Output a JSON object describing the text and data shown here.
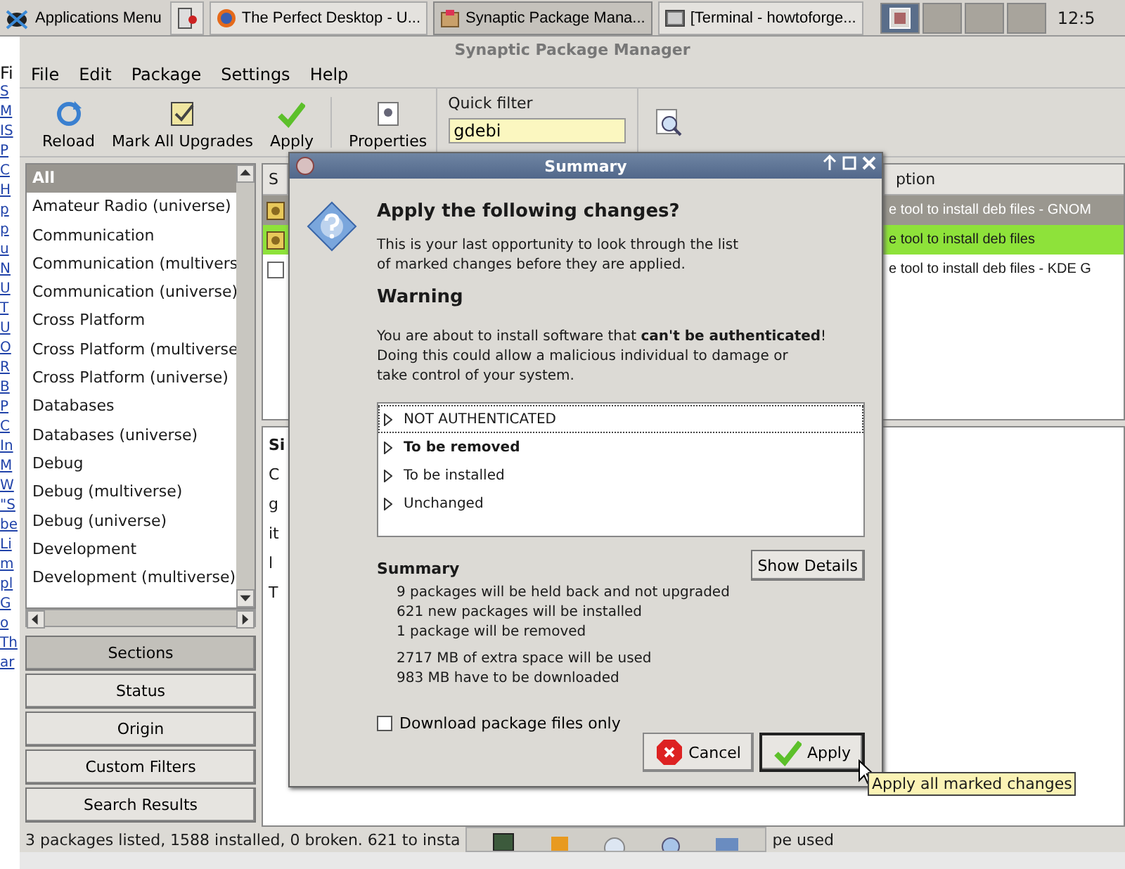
{
  "taskbar": {
    "apps_menu": "Applications Menu",
    "tasks": [
      {
        "title": "The Perfect Desktop - U...",
        "selected": false
      },
      {
        "title": "Synaptic Package Mana...",
        "selected": true
      },
      {
        "title": "[Terminal - howtoforge...",
        "selected": false
      }
    ],
    "workspaces": [
      {
        "selected": true
      },
      {
        "selected": false
      },
      {
        "selected": false
      },
      {
        "selected": false
      }
    ],
    "clock": "12:5"
  },
  "browser_fragments": [
    "Fi",
    "S",
    "M",
    "IS",
    "P",
    "C",
    "H",
    "p",
    "p",
    "u",
    "N",
    "U",
    "T",
    "U",
    "O",
    "R",
    "B",
    "P",
    "C",
    "In",
    "M",
    "W",
    "\"S",
    "be",
    "Li",
    "m",
    "pl",
    "G",
    "o",
    "Th",
    "ar"
  ],
  "window": {
    "title": "Synaptic Package Manager",
    "menu": [
      "File",
      "Edit",
      "Package",
      "Settings",
      "Help"
    ],
    "toolbar": [
      {
        "label": "Reload",
        "kind": "reload"
      },
      {
        "label": "Mark All Upgrades",
        "kind": "upgrade"
      },
      {
        "label": "Apply",
        "kind": "apply"
      },
      {
        "label": "Properties",
        "kind": "properties"
      }
    ],
    "quick_filter": {
      "label": "Quick filter",
      "value": "gdebi"
    }
  },
  "sections": [
    {
      "label": "All",
      "selected": true
    },
    {
      "label": "Amateur Radio (universe)",
      "selected": false
    },
    {
      "label": "Communication",
      "selected": false
    },
    {
      "label": "Communication (multivers",
      "selected": false
    },
    {
      "label": "Communication (universe)",
      "selected": false
    },
    {
      "label": "Cross Platform",
      "selected": false
    },
    {
      "label": "Cross Platform (multiverse",
      "selected": false
    },
    {
      "label": "Cross Platform (universe)",
      "selected": false
    },
    {
      "label": "Databases",
      "selected": false
    },
    {
      "label": "Databases (universe)",
      "selected": false
    },
    {
      "label": "Debug",
      "selected": false
    },
    {
      "label": "Debug (multiverse)",
      "selected": false
    },
    {
      "label": "Debug (universe)",
      "selected": false
    },
    {
      "label": "Development",
      "selected": false
    },
    {
      "label": "Development (multiverse)",
      "selected": false
    }
  ],
  "filter_buttons": [
    {
      "label": "Sections",
      "selected": true
    },
    {
      "label": "Status",
      "selected": false
    },
    {
      "label": "Origin",
      "selected": false
    },
    {
      "label": "Custom Filters",
      "selected": false
    },
    {
      "label": "Search Results",
      "selected": false
    }
  ],
  "packages": {
    "columns": [
      "S",
      "ption"
    ],
    "rows": [
      {
        "installed": true,
        "description": "e tool to install deb files - GNOM",
        "selected": true,
        "marked": false
      },
      {
        "installed": true,
        "description": "e tool to install deb files",
        "selected": false,
        "marked": true
      },
      {
        "installed": false,
        "description": "e tool to install deb files - KDE G",
        "selected": false,
        "marked": false
      }
    ]
  },
  "details_fragments": [
    "Si",
    "C",
    "g",
    "it",
    "l",
    "T"
  ],
  "status_bar": [
    "3 packages listed, 1588 installed, 0 broken. 621 to insta",
    "pe used"
  ],
  "dialog": {
    "title": "Summary",
    "heading": "Apply the following changes?",
    "intro": [
      "This is your last opportunity to look through the list",
      "of marked changes before they are applied."
    ],
    "warning_title": "Warning",
    "warning": [
      "You are about to install software that **can't be authenticated**!",
      "Doing this could allow a malicious individual to damage or",
      "take control of your system."
    ],
    "changes": [
      {
        "label": "NOT AUTHENTICATED",
        "bold": false,
        "focused": true
      },
      {
        "label": "To be removed",
        "bold": true,
        "focused": false
      },
      {
        "label": "To be installed",
        "bold": false,
        "focused": false
      },
      {
        "label": "Unchanged",
        "bold": false,
        "focused": false
      }
    ],
    "summary_title": "Summary",
    "show_details": "Show Details",
    "summary_groups": [
      [
        "9 packages will be held back and not upgraded",
        "621 new packages will be installed",
        "1 package will be removed"
      ],
      [
        "2717 MB of extra space will be used",
        "983 MB have to be downloaded"
      ]
    ],
    "download_only": {
      "label": "Download package files only",
      "checked": false
    },
    "buttons": [
      {
        "label": "Cancel",
        "kind": "cancel",
        "default": false
      },
      {
        "label": "Apply",
        "kind": "apply",
        "default": true
      }
    ]
  },
  "tooltip": "Apply all marked changes"
}
